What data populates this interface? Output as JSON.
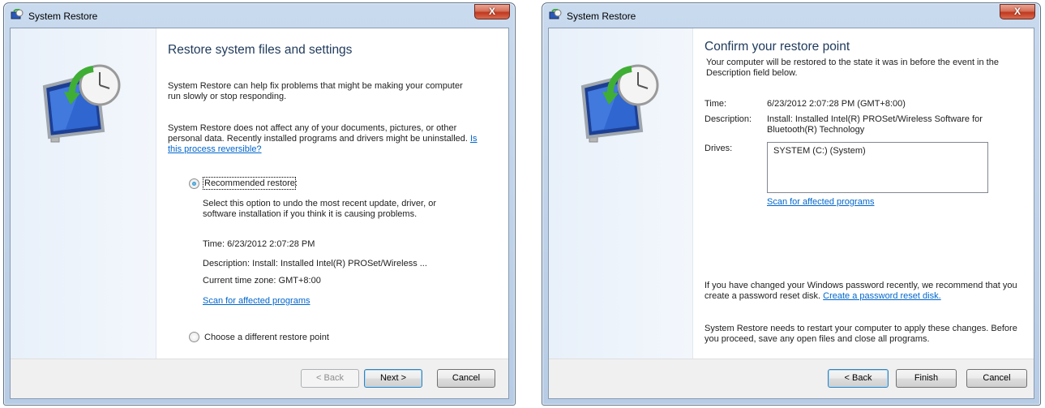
{
  "windows": {
    "left": {
      "title": "System Restore",
      "close_label": "X",
      "heading": "Restore system files and settings",
      "intro1": "System Restore can help fix problems that might be making your computer run slowly or stop responding.",
      "intro2": "System Restore does not affect any of your documents, pictures, or other personal data. Recently installed programs and drivers might be uninstalled.",
      "reversible_link": "Is this process reversible?",
      "recommended_label": "Recommended restore:",
      "recommended_desc": "Select this option to undo the most recent update, driver, or software installation if you think it is causing problems.",
      "time_text": "Time: 6/23/2012 2:07:28 PM",
      "description_text": "Description: Install: Installed Intel(R) PROSet/Wireless ...",
      "timezone_text": "Current time zone: GMT+8:00",
      "scan_link": "Scan for affected programs",
      "choose_label": "Choose a different restore point",
      "back_label": "< Back",
      "next_label": "Next >",
      "cancel_label": "Cancel"
    },
    "right": {
      "title": "System Restore",
      "close_label": "X",
      "heading": "Confirm your restore point",
      "intro": "Your computer will be restored to the state it was in before the event in the Description field below.",
      "time_label": "Time:",
      "time_value": "6/23/2012 2:07:28 PM (GMT+8:00)",
      "description_label": "Description:",
      "description_value": "Install: Installed Intel(R) PROSet/Wireless Software for Bluetooth(R) Technology",
      "drives_label": "Drives:",
      "drives_value": "SYSTEM (C:) (System)",
      "scan_link": "Scan for affected programs",
      "password_text": "If you have changed your Windows password recently, we recommend that you create a password reset disk.",
      "password_link": "Create a password reset disk.",
      "restart_text": "System Restore needs to restart your computer to apply these changes. Before you proceed, save any open files and close all programs.",
      "back_label": "< Back",
      "finish_label": "Finish",
      "cancel_label": "Cancel"
    }
  },
  "icons": {
    "app": "system-restore-icon",
    "hero": "monitor-clock-restore-icon",
    "close": "close-icon"
  },
  "colors": {
    "heading": "#1e395b",
    "link": "#0066cc",
    "close_button": "#c0391f"
  }
}
